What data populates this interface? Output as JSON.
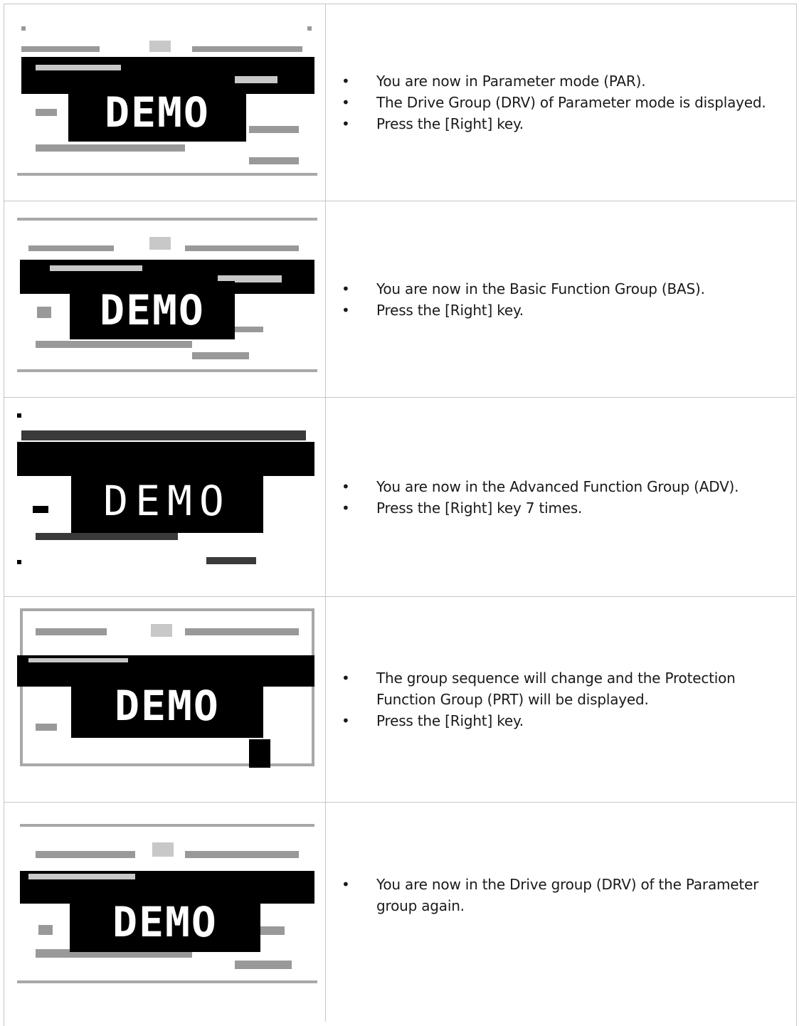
{
  "watermark": "DEMO",
  "rows": [
    {
      "bullets": [
        "You are now in Parameter mode (PAR).",
        "The Drive Group (DRV) of Parameter mode is displayed.",
        "Press the [Right] key."
      ]
    },
    {
      "bullets": [
        "You are now in the Basic Function Group (BAS).",
        "Press the [Right] key."
      ]
    },
    {
      "bullets": [
        "You are now in the Advanced Function Group (ADV).",
        "Press the [Right] key 7 times."
      ]
    },
    {
      "bullets": [
        "The group sequence will change and the Protection Function Group (PRT) will be displayed.",
        "Press the [Right] key."
      ]
    },
    {
      "bullets": [
        "You are now in the Drive group (DRV) of the Parameter group again."
      ]
    }
  ],
  "bullet_glyph": "•"
}
